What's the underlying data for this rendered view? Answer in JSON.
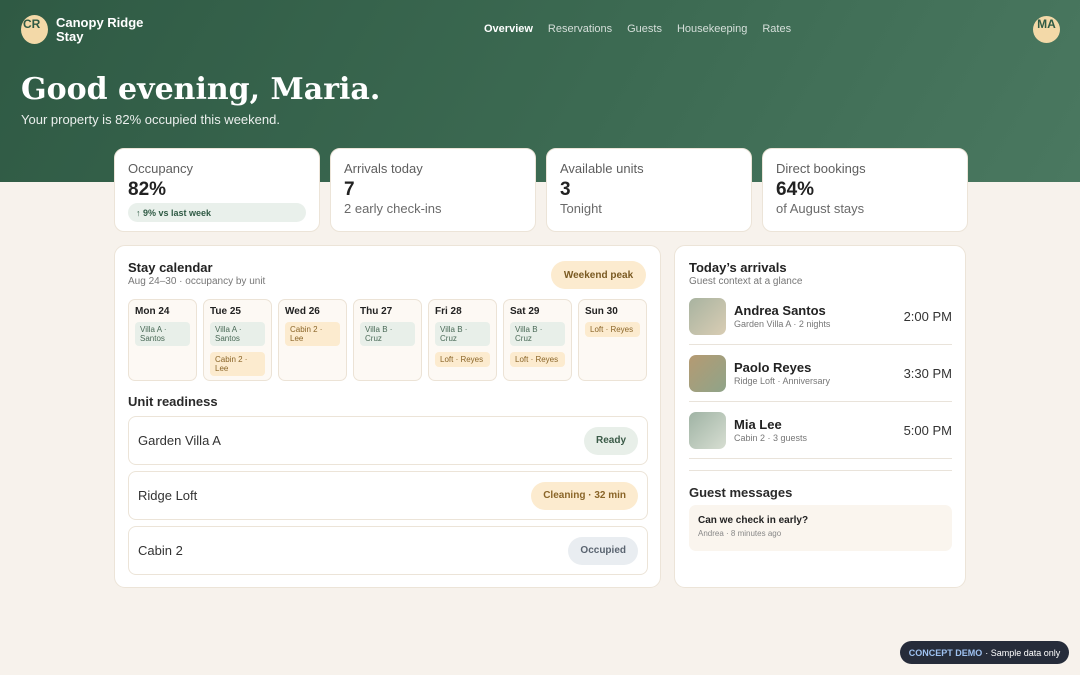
{
  "header": {
    "logo_initials": "CR",
    "brand": "Canopy Ridge Stay",
    "nav": [
      "Overview",
      "Reservations",
      "Guests",
      "Housekeeping",
      "Rates"
    ],
    "active_nav": "Overview",
    "user_initials": "MA",
    "greeting": "Good evening, Maria.",
    "subtitle": "Your property is 82% occupied this weekend."
  },
  "stats": [
    {
      "label": "Occupancy",
      "value": "82%",
      "pill": "↑ 9% vs last week"
    },
    {
      "label": "Arrivals today",
      "value": "7",
      "sub": "2 early check-ins"
    },
    {
      "label": "Available units",
      "value": "3",
      "sub": "Tonight"
    },
    {
      "label": "Direct bookings",
      "value": "64%",
      "sub": "of August stays"
    }
  ],
  "calendar": {
    "title": "Stay calendar",
    "subtitle": "Aug 24–30 · occupancy by unit",
    "badge": "Weekend peak",
    "days": [
      {
        "name": "Mon 24",
        "stays": [
          {
            "label": "Villa A · Santos",
            "tone": "green"
          }
        ]
      },
      {
        "name": "Tue 25",
        "stays": [
          {
            "label": "Villa A · Santos",
            "tone": "green"
          },
          {
            "label": "Cabin 2 · Lee",
            "tone": "amber"
          }
        ]
      },
      {
        "name": "Wed 26",
        "stays": [
          {
            "label": "Cabin 2 · Lee",
            "tone": "amber"
          }
        ]
      },
      {
        "name": "Thu 27",
        "stays": [
          {
            "label": "Villa B · Cruz",
            "tone": "green"
          }
        ]
      },
      {
        "name": "Fri 28",
        "stays": [
          {
            "label": "Villa B · Cruz",
            "tone": "green"
          },
          {
            "label": "Loft · Reyes",
            "tone": "amber"
          }
        ]
      },
      {
        "name": "Sat 29",
        "stays": [
          {
            "label": "Villa B · Cruz",
            "tone": "green"
          },
          {
            "label": "Loft · Reyes",
            "tone": "amber"
          }
        ]
      },
      {
        "name": "Sun 30",
        "stays": [
          {
            "label": "Loft · Reyes",
            "tone": "amber"
          }
        ]
      }
    ]
  },
  "readiness": {
    "title": "Unit readiness",
    "units": [
      {
        "name": "Garden Villa A",
        "status": "Ready",
        "tone": "ready"
      },
      {
        "name": "Ridge Loft",
        "status": "Cleaning · 32 min",
        "tone": "cleaning"
      },
      {
        "name": "Cabin 2",
        "status": "Occupied",
        "tone": "occupied"
      }
    ]
  },
  "arrivals": {
    "title": "Today’s arrivals",
    "subtitle": "Guest context at a glance",
    "items": [
      {
        "name": "Andrea Santos",
        "meta": "Garden Villa A · 2 nights",
        "time": "2:00 PM",
        "photo": "linear-gradient(135deg,#a8b3a0,#d9cdb4)"
      },
      {
        "name": "Paolo Reyes",
        "meta": "Ridge Loft · Anniversary",
        "time": "3:30 PM",
        "photo": "linear-gradient(135deg,#b59a72,#8fa489)"
      },
      {
        "name": "Mia Lee",
        "meta": "Cabin 2 · 3 guests",
        "time": "5:00 PM",
        "photo": "linear-gradient(135deg,#9fb3a4,#d7ded2)"
      }
    ]
  },
  "messages": {
    "title": "Guest messages",
    "items": [
      {
        "text": "Can we check in early?",
        "meta": "Andrea · 8 minutes ago"
      }
    ]
  },
  "footer": {
    "demo_tag": "CONCEPT DEMO",
    "demo_text": "· Sample data only"
  }
}
